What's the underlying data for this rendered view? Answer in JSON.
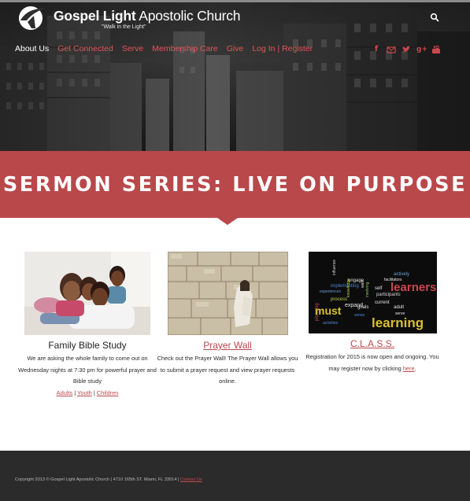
{
  "site": {
    "name_bold": "Gospel Light",
    "name_regular": "Apostolic Church",
    "tagline": "\"Walk in the Light\""
  },
  "nav": {
    "items": [
      {
        "label": "About Us",
        "active": true
      },
      {
        "label": "Get Connected",
        "active": false
      },
      {
        "label": "Serve",
        "active": false
      },
      {
        "label": "Membership Care",
        "active": false
      },
      {
        "label": "Give",
        "active": false
      },
      {
        "label": "Log In | Register",
        "active": false
      }
    ],
    "search_icon": "search-icon",
    "social_icons": [
      "facebook-icon",
      "email-icon",
      "twitter-icon",
      "google-plus-icon",
      "youtube-icon"
    ]
  },
  "banner": {
    "title": "SERMON SERIES: LIVE ON PURPOSE",
    "color": "#b9484b"
  },
  "columns": [
    {
      "title": "Family Bible Study",
      "description": "We are asking the whole family to come out on Wednesday nights at 7:30 pm for powerful prayer and Bible study",
      "links": [
        "Adults",
        "Youth",
        "Children"
      ]
    },
    {
      "title": "Prayer Wall",
      "description": "Check out the Prayer Wall! The Prayer Wall allows you to submit a prayer request and view prayer requests online."
    },
    {
      "title": "C.L.A.S.S.",
      "description_before": "Registration for 2015 is now open and ongoing. You may register now by clicking ",
      "link_text": "here",
      "description_after": ".",
      "cloud_words": [
        "learners",
        "learning",
        "must",
        "goals",
        "expand",
        "process",
        "implementing",
        "engage",
        "influence",
        "participants",
        "actively",
        "facilitators",
        "knowledge",
        "current",
        "adult",
        "serve",
        "activities",
        "planning",
        "sense",
        "want",
        "self",
        "involving",
        "experiences",
        "engaging",
        "their"
      ]
    }
  ],
  "footer": {
    "copyright": "Copyright 2013 © Gospel Light Apostolic Church | 4710 165th ST. Miami, FL 33014 | ",
    "contact_link": "Contact Us"
  },
  "colors": {
    "accent": "#c9474c",
    "banner": "#b9484b",
    "footer": "#2b2b2b"
  }
}
